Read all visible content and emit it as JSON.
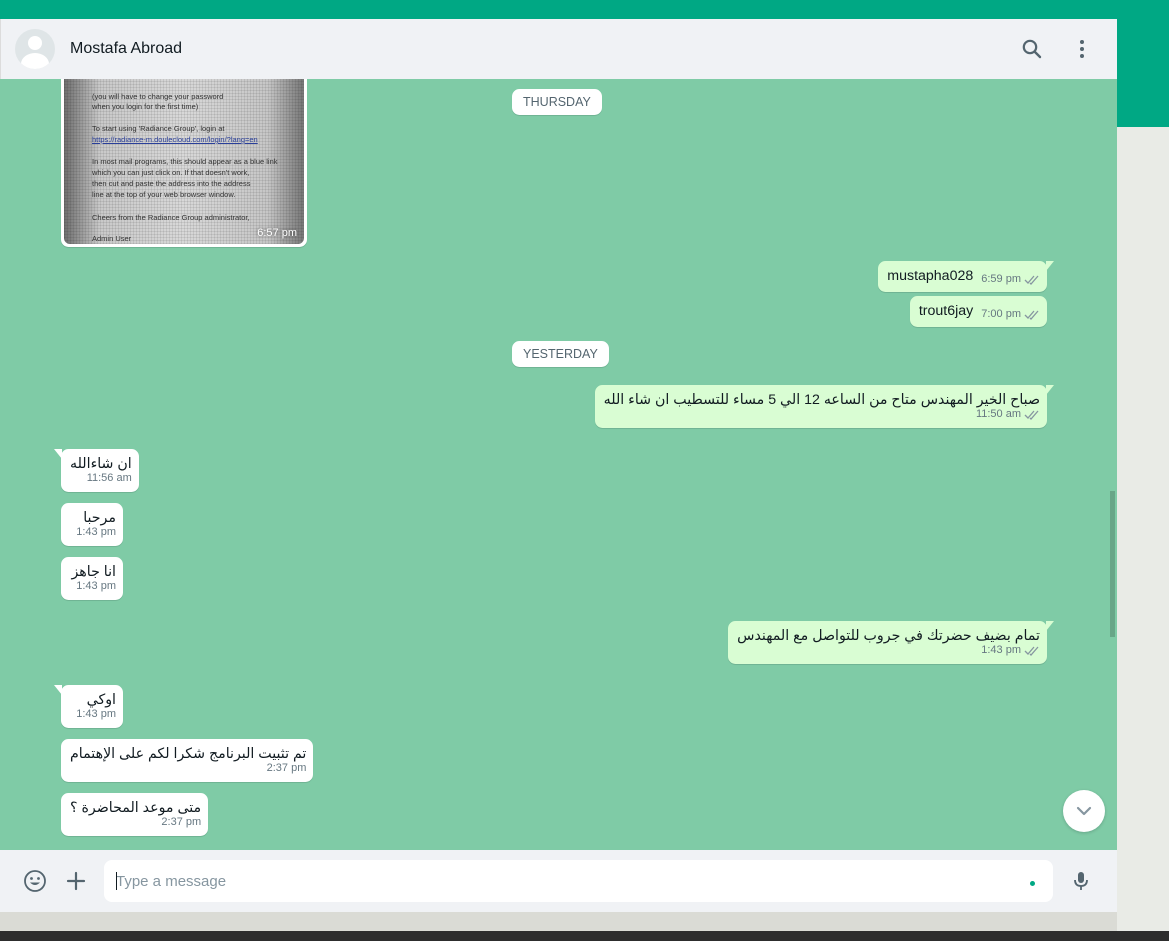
{
  "colors": {
    "accent": "#00a884",
    "wallpaper": "#7fcba6",
    "bubble_outgoing": "#d9fdd3",
    "bubble_incoming": "#ffffff",
    "read_tick": "#8696a0"
  },
  "header": {
    "contact_name": "Mostafa Abroad",
    "icons": [
      "avatar-icon",
      "search-icon",
      "menu-icon"
    ]
  },
  "image_message": {
    "time": "6:57 pm",
    "doc_lines": [
      "(you will have to change your password",
      "when you login for the first time)",
      "To start using 'Radiance Group', login at",
      "https://radiance-m.doulecloud.com/login/?lang=en",
      "In most mail programs, this should appear as a blue link",
      "which you can just click on. If that doesn't work,",
      "then cut and paste the address into the address",
      "line at the top of your web browser window.",
      "Cheers from the Radiance Group administrator,",
      "Admin User"
    ]
  },
  "date_separators": {
    "thursday": "THURSDAY",
    "yesterday": "YESTERDAY"
  },
  "messages": [
    {
      "dir": "out",
      "text": "mustapha028",
      "time": "6:59 pm"
    },
    {
      "dir": "out",
      "text": "trout6jay",
      "time": "7:00 pm"
    },
    {
      "dir": "out",
      "text": "صباح الخير المهندس متاح من الساعه 12 الي 5 مساء للتسطيب ان شاء الله",
      "time": "11:50 am"
    },
    {
      "dir": "in",
      "text": "ان شاءالله",
      "time": "11:56 am"
    },
    {
      "dir": "in",
      "text": "مرحبا",
      "time": "1:43 pm"
    },
    {
      "dir": "in",
      "text": "انا جاهز",
      "time": "1:43 pm"
    },
    {
      "dir": "out",
      "text": "تمام بضيف حضرتك في جروب للتواصل مع المهندس",
      "time": "1:43 pm"
    },
    {
      "dir": "in",
      "text": "اوكي",
      "time": "1:43 pm"
    },
    {
      "dir": "in",
      "text": "تم تثبيت البرنامج شكرا لكم على الإهتمام",
      "time": "2:37 pm"
    },
    {
      "dir": "in",
      "text": "متى موعد المحاضرة ؟",
      "time": "2:37 pm"
    }
  ],
  "composer": {
    "placeholder": "Type a message",
    "icons": [
      "emoji-icon",
      "attach-icon",
      "mic-icon"
    ]
  }
}
